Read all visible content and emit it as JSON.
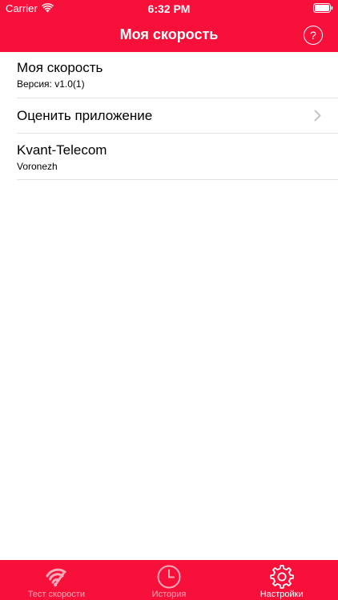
{
  "status_bar": {
    "carrier": "Carrier",
    "time": "6:32 PM"
  },
  "nav": {
    "title": "Моя скорость",
    "help_symbol": "?"
  },
  "list": {
    "about": {
      "title": "Моя скорость",
      "subtitle": "Версия: v1.0(1)"
    },
    "rate": {
      "title": "Оценить приложение"
    },
    "provider": {
      "title": "Kvant-Telecom",
      "subtitle": "Voronezh"
    }
  },
  "tabs": [
    {
      "label": "Тест скорости",
      "icon": "wifi-speed-icon",
      "active": false
    },
    {
      "label": "История",
      "icon": "clock-icon",
      "active": false
    },
    {
      "label": "Настройки",
      "icon": "gear-icon",
      "active": true
    }
  ],
  "colors": {
    "accent": "#f7103a",
    "tab_inactive": "#f9aab8",
    "separator": "#e3e3e6",
    "chevron": "#c4c4c9"
  }
}
